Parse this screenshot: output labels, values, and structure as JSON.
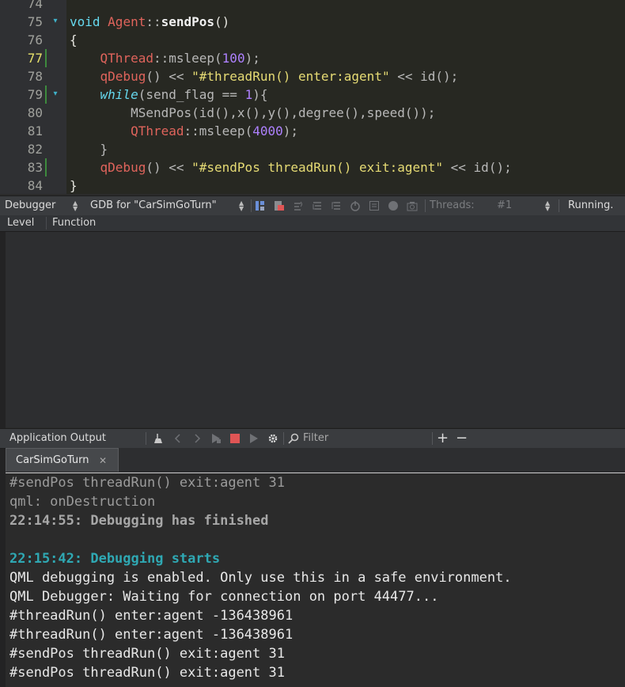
{
  "editor": {
    "lines": [
      {
        "num": "74",
        "code": "",
        "fold": false,
        "changed": false,
        "current": false
      },
      {
        "num": "75",
        "fold": true,
        "changed": false,
        "current": false,
        "tokens": [
          [
            "kw",
            "void"
          ],
          [
            "",
            "  "
          ],
          [
            "type",
            "Agent"
          ],
          [
            "dim",
            "::"
          ],
          [
            "fn",
            "sendPos"
          ],
          [
            "",
            "()"
          ]
        ]
      },
      {
        "num": "76",
        "fold": false,
        "changed": false,
        "current": false,
        "tokens": [
          [
            "",
            "{"
          ]
        ]
      },
      {
        "num": "77",
        "fold": false,
        "changed": true,
        "current": true,
        "tokens": [
          [
            "",
            "    "
          ],
          [
            "type",
            "QThread"
          ],
          [
            "dim",
            "::msleep("
          ],
          [
            "num",
            "100"
          ],
          [
            "dim",
            ");"
          ]
        ]
      },
      {
        "num": "78",
        "fold": false,
        "changed": false,
        "current": false,
        "tokens": [
          [
            "",
            "    "
          ],
          [
            "type",
            "qDebug"
          ],
          [
            "dim",
            "() << "
          ],
          [
            "str",
            "\"#threadRun() enter:agent\""
          ],
          [
            "dim",
            " << id();"
          ]
        ]
      },
      {
        "num": "79",
        "fold": true,
        "changed": true,
        "current": false,
        "tokens": [
          [
            "",
            "    "
          ],
          [
            "kwi",
            "while"
          ],
          [
            "dim",
            "(send_flag == "
          ],
          [
            "num",
            "1"
          ],
          [
            "dim",
            "){"
          ]
        ]
      },
      {
        "num": "80",
        "fold": false,
        "changed": false,
        "current": false,
        "tokens": [
          [
            "",
            "        "
          ],
          [
            "dim",
            "MSendPos(id(),x(),y(),degree(),speed());"
          ]
        ]
      },
      {
        "num": "81",
        "fold": false,
        "changed": false,
        "current": false,
        "tokens": [
          [
            "",
            "        "
          ],
          [
            "type",
            "QThread"
          ],
          [
            "dim",
            "::msleep("
          ],
          [
            "num",
            "4000"
          ],
          [
            "dim",
            ");"
          ]
        ]
      },
      {
        "num": "82",
        "fold": false,
        "changed": false,
        "current": false,
        "tokens": [
          [
            "",
            "    "
          ],
          [
            "dim",
            "}"
          ]
        ]
      },
      {
        "num": "83",
        "fold": false,
        "changed": true,
        "current": false,
        "tokens": [
          [
            "",
            "    "
          ],
          [
            "type",
            "qDebug"
          ],
          [
            "dim",
            "() << "
          ],
          [
            "str",
            "\"#sendPos threadRun() exit:agent\""
          ],
          [
            "dim",
            " << id();"
          ]
        ]
      },
      {
        "num": "84",
        "fold": false,
        "changed": false,
        "current": false,
        "tokens": [
          [
            "",
            "}"
          ]
        ]
      }
    ]
  },
  "debug_toolbar": {
    "view_combo": "Debugger",
    "engine_combo": "GDB for \"CarSimGoTurn\"",
    "threads_label": "Threads:",
    "thread_value": "#1",
    "status": "Running."
  },
  "stack": {
    "col_level": "Level",
    "col_function": "Function"
  },
  "output_toolbar": {
    "title": "Application Output",
    "filter_placeholder": "Filter",
    "plus": "+",
    "minus": "−"
  },
  "output_tab": {
    "label": "CarSimGoTurn",
    "close": "✕"
  },
  "output": {
    "lines": [
      {
        "text": "#sendPos threadRun() exit:agent 31",
        "style": "gray"
      },
      {
        "text": "qml: onDestruction",
        "style": "gray"
      },
      {
        "text": "22:14:55: Debugging has finished",
        "style": "bold-gray"
      },
      {
        "text": "",
        "style": "normal"
      },
      {
        "text": "22:15:42: Debugging starts",
        "style": "teal"
      },
      {
        "text": "QML debugging is enabled. Only use this in a safe environment.",
        "style": "normal"
      },
      {
        "text": "QML Debugger: Waiting for connection on port 44477...",
        "style": "normal"
      },
      {
        "text": "#threadRun() enter:agent -136438961",
        "style": "normal"
      },
      {
        "text": "#threadRun() enter:agent -136438961",
        "style": "normal"
      },
      {
        "text": "#sendPos threadRun() exit:agent 31",
        "style": "normal"
      },
      {
        "text": "#sendPos threadRun() exit:agent 31",
        "style": "normal"
      }
    ]
  },
  "colors": {
    "editor_bg": "#272822",
    "keyword": "#66d9ef",
    "type": "#e0645c",
    "string": "#e6db74",
    "number": "#ae81ff",
    "output_timestamp": "#2fa8b3",
    "stop_red": "#e05555"
  }
}
